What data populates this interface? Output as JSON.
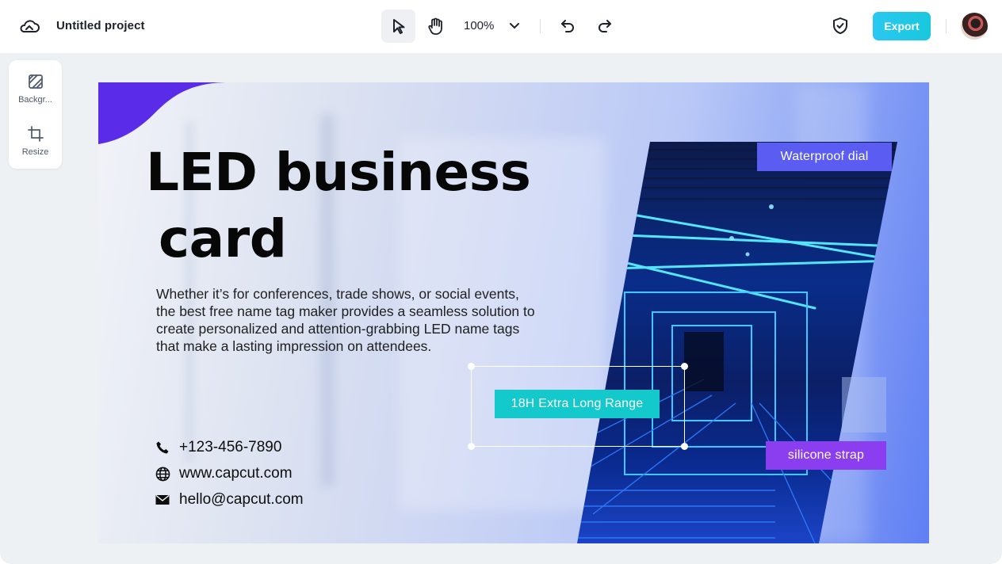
{
  "header": {
    "project_title": "Untitled project",
    "zoom": "100%",
    "export_label": "Export"
  },
  "sidebar": {
    "items": [
      {
        "label": "Backgr...",
        "icon": "background-icon"
      },
      {
        "label": "Resize",
        "icon": "resize-icon"
      }
    ]
  },
  "design": {
    "headline_line1": "LED business",
    "headline_line2": "card",
    "body": "Whether it’s for conferences, trade shows, or social events, the best free name tag maker provides a seamless solution to create personalized and attention-grabbing LED name tags that make a lasting impression on attendees.",
    "contacts": [
      {
        "icon": "phone-icon",
        "text": "+123-456-7890"
      },
      {
        "icon": "globe-icon",
        "text": "www.capcut.com"
      },
      {
        "icon": "mail-icon",
        "text": "hello@capcut.com"
      }
    ],
    "tags": {
      "waterproof": "Waterproof dial",
      "range": "18H Extra Long Range",
      "strap": "silicone strap"
    }
  },
  "colors": {
    "export_button": "#18c8dd",
    "tag_waterproof": "#5a5cf2",
    "tag_range": "#14c9cc",
    "tag_strap": "#8b3df0",
    "corner_shape": "#5b2bea"
  }
}
